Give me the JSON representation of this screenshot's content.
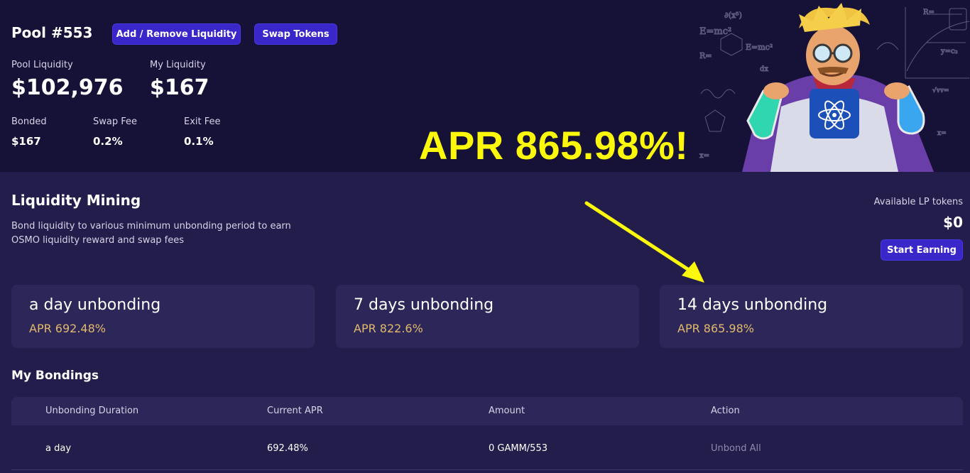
{
  "header": {
    "title": "Pool #553",
    "add_remove_label": "Add / Remove Liquidity",
    "swap_label": "Swap Tokens"
  },
  "stats": {
    "pool_liquidity_label": "Pool Liquidity",
    "pool_liquidity_value": "$102,976",
    "my_liquidity_label": "My Liquidity",
    "my_liquidity_value": "$167",
    "bonded_label": "Bonded",
    "bonded_value": "$167",
    "swap_fee_label": "Swap Fee",
    "swap_fee_value": "0.2%",
    "exit_fee_label": "Exit Fee",
    "exit_fee_value": "0.1%"
  },
  "overlay": {
    "apr_text": "APR 865.98%!",
    "color": "#fbf80c"
  },
  "mining": {
    "title": "Liquidity Mining",
    "description_line1": "Bond liquidity to various minimum unbonding period to earn",
    "description_line2": "OSMO liquidity reward and swap fees",
    "lp_label": "Available LP tokens",
    "lp_value": "$0",
    "start_label": "Start Earning"
  },
  "cards": [
    {
      "title": "a day unbonding",
      "apr": "APR 692.48%"
    },
    {
      "title": "7 days unbonding",
      "apr": "APR 822.6%"
    },
    {
      "title": "14 days unbonding",
      "apr": "APR 865.98%"
    }
  ],
  "bondings": {
    "title": "My Bondings",
    "columns": [
      "Unbonding Duration",
      "Current APR",
      "Amount",
      "Action"
    ],
    "rows": [
      {
        "duration": "a day",
        "apr": "692.48%",
        "amount": "0 GAMM/553",
        "action": "Unbond All"
      }
    ]
  },
  "colors": {
    "top_bg": "#161136",
    "page_bg": "#231d4b",
    "card_bg": "#2c2758",
    "accent_button": "#3a27c9",
    "apr_gold": "#e3b96c"
  }
}
